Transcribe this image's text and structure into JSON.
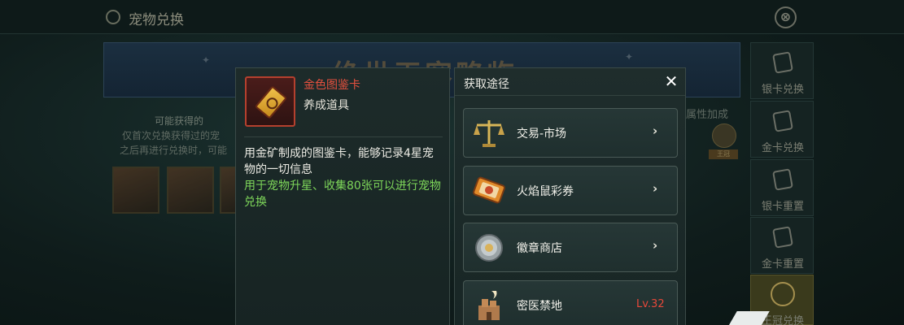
{
  "page": {
    "title": "宠物兑换",
    "close_symbol": "⊗"
  },
  "background": {
    "banner_text": "绝世玉容略临",
    "left_heading": "可能获得的",
    "left_line1": "仅首次兑换获得过的宠",
    "left_line2": "之后再进行兑换时，可能",
    "right_text": "属性加成",
    "crown_tag": "王冠"
  },
  "side_tabs": [
    {
      "label": "银卡兑换",
      "icon": "silver-card-icon"
    },
    {
      "label": "金卡兑换",
      "icon": "gold-card-icon"
    },
    {
      "label": "银卡重置",
      "icon": "silver-reset-icon"
    },
    {
      "label": "金卡重置",
      "icon": "gold-reset-icon"
    },
    {
      "label": "王冠兑换",
      "icon": "crown-icon"
    }
  ],
  "item": {
    "name": "金色图鉴卡",
    "type": "养成道具",
    "description": "用金矿制成的图鉴卡，能够记录4星宠物的一切信息",
    "usage": "用于宠物升星、收集80张可以进行宠物兑换",
    "name_color": "#e5503e",
    "usage_color": "#7ed75a"
  },
  "route": {
    "title": "获取途径",
    "close_symbol": "✕",
    "items": [
      {
        "label": "交易-市场",
        "icon": "scale-icon",
        "arrow": "›",
        "level": ""
      },
      {
        "label": "火焰鼠彩券",
        "icon": "lottery-ticket-icon",
        "arrow": "›",
        "level": ""
      },
      {
        "label": "徽章商店",
        "icon": "badge-coin-icon",
        "arrow": "›",
        "level": ""
      },
      {
        "label": "密医禁地",
        "icon": "castle-icon",
        "arrow": "",
        "level": "Lv.32"
      }
    ]
  }
}
